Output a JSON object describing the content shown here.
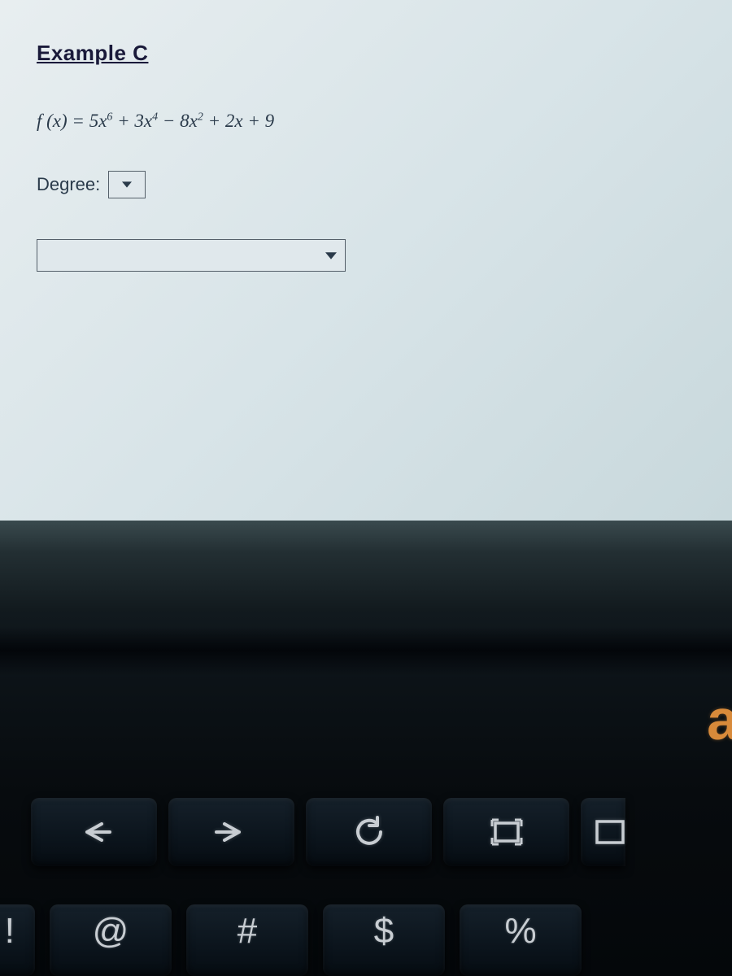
{
  "page": {
    "title": "Example C",
    "equation_html": "f (x) = 5x<sup>6</sup> + 3x<sup>4</sup> − 8x<sup>2</sup> + 2x + 9",
    "degree_label": "Degree:"
  },
  "logo_fragment": "a",
  "keyboard": {
    "fn_row": [
      {
        "name": "back-key",
        "symbol": "←"
      },
      {
        "name": "forward-key",
        "symbol": "→"
      },
      {
        "name": "refresh-key",
        "symbol": "↻"
      },
      {
        "name": "fullscreen-key",
        "symbol": "⛶"
      },
      {
        "name": "overview-key",
        "symbol": "▭"
      }
    ],
    "num_row": [
      {
        "name": "exclaim-key",
        "symbol": "!"
      },
      {
        "name": "at-key",
        "symbol": "@"
      },
      {
        "name": "hash-key",
        "symbol": "#"
      },
      {
        "name": "dollar-key",
        "symbol": "$"
      },
      {
        "name": "percent-key",
        "symbol": "%"
      }
    ]
  }
}
